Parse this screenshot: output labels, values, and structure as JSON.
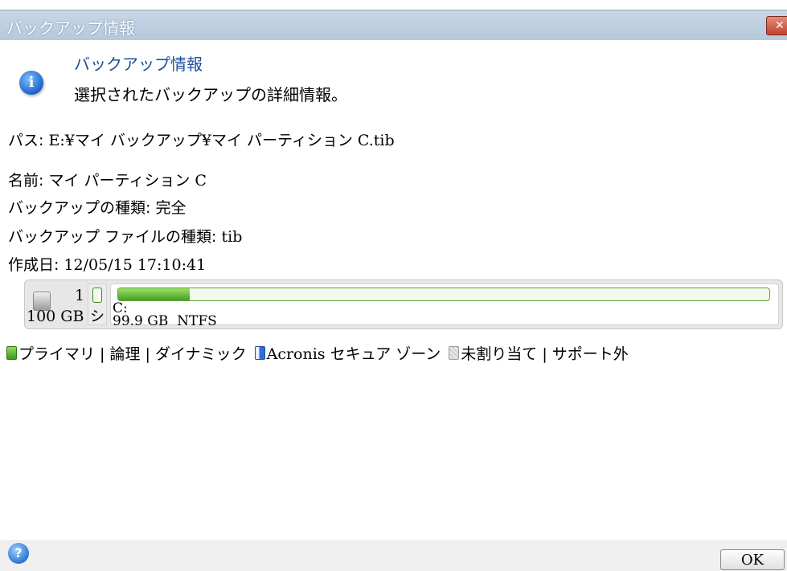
{
  "window": {
    "title": "バックアップ情報",
    "close_glyph": "✕"
  },
  "header": {
    "title": "バックアップ情報",
    "subtitle": "選択されたバックアップの詳細情報。",
    "icon": "info-icon"
  },
  "details": {
    "path_label": "パス:",
    "path_value": "E:¥マイ バックアップ¥マイ パーティション C.tib",
    "name_label": "名前:",
    "name_value": "マイ パーティション C",
    "type_label": "バックアップの種類:",
    "type_value": "完全",
    "file_type_label": "バックアップ ファイルの種類:",
    "file_type_value": "tib",
    "created_label": "作成日:",
    "created_value": "12/05/15 17:10:41"
  },
  "disk": {
    "number": "1",
    "size": "100 GB",
    "system_partition_label": "シ",
    "partition_name": "C:",
    "partition_size": "99.9 GB",
    "partition_fs": "NTFS",
    "used_fraction": 0.11
  },
  "legend": {
    "primary": "プライマリ | 論理 | ダイナミック",
    "acronis": "Acronis セキュア ゾーン",
    "unallocated": "未割り当て | サポート外"
  },
  "colors": {
    "partition_green": "#46a022",
    "title_blue": "#1d4e9c"
  },
  "footer": {
    "ok_label": "OK",
    "help_icon": "help-icon"
  }
}
